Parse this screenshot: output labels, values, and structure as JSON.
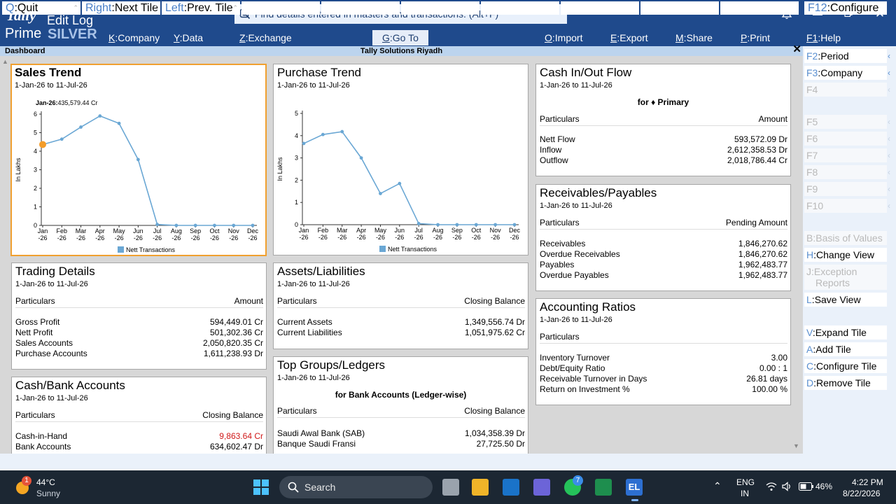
{
  "app": {
    "logo_line1": "Tally",
    "logo_line2": "Prime",
    "edition": "SILVER",
    "title": "Edit Log",
    "search_placeholder": "Find details entered in masters and transactions. (Alt+F)"
  },
  "menu": [
    {
      "key": "K",
      "label": "Company"
    },
    {
      "key": "Y",
      "label": "Data"
    },
    {
      "key": "Z",
      "label": "Exchange"
    },
    {
      "key": "G",
      "label": "Go To"
    },
    {
      "key": "O",
      "label": "Import"
    },
    {
      "key": "E",
      "label": "Export"
    },
    {
      "key": "M",
      "label": "Share"
    },
    {
      "key": "P",
      "label": "Print"
    },
    {
      "key": "F1",
      "label": "Help"
    }
  ],
  "subheader": {
    "left": "Dashboard",
    "center": "Tally Solutions Riyadh"
  },
  "tiles": {
    "sales_trend": {
      "title": "Sales Trend",
      "date": "1-Jan-26 to 11-Jul-26",
      "tooltip_label": "Jan-26:",
      "tooltip_value": "435,579.44 Cr"
    },
    "purchase_trend": {
      "title": "Purchase Trend",
      "date": "1-Jan-26 to 11-Jul-26"
    },
    "cash_flow": {
      "title": "Cash In/Out Flow",
      "date": "1-Jan-26 to 11-Jul-26",
      "for": "for ♦ Primary",
      "col1": "Particulars",
      "col2": "Amount",
      "rows": [
        {
          "label": "Nett Flow",
          "value": "593,572.09 Dr"
        },
        {
          "label": "Inflow",
          "value": "2,612,358.53 Dr"
        },
        {
          "label": "Outflow",
          "value": "2,018,786.44 Cr"
        }
      ]
    },
    "receivables": {
      "title": "Receivables/Payables",
      "date": "1-Jan-26 to 11-Jul-26",
      "col1": "Particulars",
      "col2": "Pending Amount",
      "rows": [
        {
          "label": "Receivables",
          "value": "1,846,270.62"
        },
        {
          "label": "Overdue Receivables",
          "value": "1,846,270.62"
        },
        {
          "label": "Payables",
          "value": "1,962,483.77"
        },
        {
          "label": "Overdue Payables",
          "value": "1,962,483.77"
        }
      ]
    },
    "trading": {
      "title": "Trading Details",
      "date": "1-Jan-26 to 11-Jul-26",
      "col1": "Particulars",
      "col2": "Amount",
      "rows": [
        {
          "label": "Gross Profit",
          "value": "594,449.01 Cr"
        },
        {
          "label": "Nett Profit",
          "value": "501,302.36 Cr"
        },
        {
          "label": "Sales Accounts",
          "value": "2,050,820.35 Cr"
        },
        {
          "label": "Purchase Accounts",
          "value": "1,611,238.93 Dr"
        }
      ]
    },
    "assets": {
      "title": "Assets/Liabilities",
      "date": "1-Jan-26 to 11-Jul-26",
      "col1": "Particulars",
      "col2": "Closing Balance",
      "rows": [
        {
          "label": "Current Assets",
          "value": "1,349,556.74 Dr"
        },
        {
          "label": "Current Liabilities",
          "value": "1,051,975.62 Cr"
        }
      ]
    },
    "ratios": {
      "title": "Accounting Ratios",
      "date": "1-Jan-26 to 11-Jul-26",
      "col1": "Particulars",
      "rows": [
        {
          "label": "Inventory Turnover",
          "value": "3.00"
        },
        {
          "label": "Debt/Equity Ratio",
          "value": "0.00 : 1"
        },
        {
          "label": "Receivable Turnover in Days",
          "value": "26.81 days"
        },
        {
          "label": "Return on Investment %",
          "value": "100.00 %"
        }
      ]
    },
    "cashbank": {
      "title": "Cash/Bank Accounts",
      "date": "1-Jan-26 to 11-Jul-26",
      "col1": "Particulars",
      "col2": "Closing Balance",
      "rows": [
        {
          "label": "Cash-in-Hand",
          "value": "9,863.64 Cr",
          "negative": true
        },
        {
          "label": "Bank Accounts",
          "value": "634,602.47 Dr"
        }
      ]
    },
    "topgroups": {
      "title": "Top Groups/Ledgers",
      "date": "1-Jan-26 to 11-Jul-26",
      "for": "for Bank Accounts (Ledger-wise)",
      "col1": "Particulars",
      "col2": "Closing Balance",
      "rows": [
        {
          "label": "Saudi Awal Bank (SAB)",
          "value": "1,034,358.39 Dr"
        },
        {
          "label": "Banque Saudi Fransi",
          "value": "27,725.50 Dr"
        }
      ]
    }
  },
  "chart_data": [
    {
      "type": "line",
      "title": "Sales Trend",
      "ylabel": "In Lakhs",
      "categories": [
        "Jan\n-26",
        "Feb\n-26",
        "Mar\n-26",
        "Apr\n-26",
        "May\n-26",
        "Jun\n-26",
        "Jul\n-26",
        "Aug\n-26",
        "Sep\n-26",
        "Oct\n-26",
        "Nov\n-26",
        "Dec\n-26"
      ],
      "yticks": [
        0,
        1,
        2,
        3,
        4,
        5,
        6
      ],
      "ylim": [
        0,
        6
      ],
      "series": [
        {
          "name": "Nett Transactions",
          "values": [
            4.36,
            4.65,
            5.3,
            5.9,
            5.5,
            3.55,
            0.05,
            0,
            0,
            0,
            0,
            0
          ]
        }
      ],
      "highlight_index": 0,
      "legend": "bottom-center",
      "color": "#6aa7d4"
    },
    {
      "type": "line",
      "title": "Purchase Trend",
      "ylabel": "In Lakhs",
      "categories": [
        "Jan\n-26",
        "Feb\n-26",
        "Mar\n-26",
        "Apr\n-26",
        "May\n-26",
        "Jun\n-26",
        "Jul\n-26",
        "Aug\n-26",
        "Sep\n-26",
        "Oct\n-26",
        "Nov\n-26",
        "Dec\n-26"
      ],
      "yticks": [
        0,
        1,
        2,
        3,
        4,
        5
      ],
      "ylim": [
        0,
        5
      ],
      "series": [
        {
          "name": "Nett Transactions",
          "values": [
            3.65,
            4.05,
            4.18,
            3.0,
            1.4,
            1.85,
            0.05,
            0,
            0,
            0,
            0,
            0
          ]
        }
      ],
      "legend": "bottom-center",
      "color": "#6aa7d4"
    }
  ],
  "right_panel": [
    {
      "key": "F2",
      "label": "Period",
      "enabled": true,
      "chev": true
    },
    {
      "key": "F3",
      "label": "Company",
      "enabled": true,
      "chev": true
    },
    {
      "key": "F4",
      "label": "",
      "enabled": false
    },
    {
      "key": "F5",
      "label": "",
      "enabled": false
    },
    {
      "key": "F6",
      "label": "",
      "enabled": false
    },
    {
      "key": "F7",
      "label": "",
      "enabled": false
    },
    {
      "key": "F8",
      "label": "",
      "enabled": false
    },
    {
      "key": "F9",
      "label": "",
      "enabled": false
    },
    {
      "key": "F10",
      "label": "",
      "enabled": false
    },
    {
      "key": "B",
      "label": "Basis of Values",
      "enabled": false
    },
    {
      "key": "H",
      "label": "Change View",
      "enabled": true
    },
    {
      "key": "J",
      "label": "Exception",
      "label2": "Reports",
      "enabled": false
    },
    {
      "key": "L",
      "label": "Save View",
      "enabled": true
    },
    {
      "key": "V",
      "label": "Expand Tile",
      "enabled": true
    },
    {
      "key": "A",
      "label": "Add Tile",
      "enabled": true
    },
    {
      "key": "C",
      "label": "Configure Tile",
      "enabled": true
    },
    {
      "key": "D",
      "label": "Remove Tile",
      "enabled": true
    }
  ],
  "bottom_bar": [
    {
      "key": "Q",
      "label": "Quit"
    },
    {
      "key": "Right",
      "label": "Next Tile"
    },
    {
      "key": "Left",
      "label": "Prev. Tile"
    },
    {
      "key": "F12",
      "label": "Configure"
    }
  ],
  "taskbar": {
    "temp": "44°C",
    "condition": "Sunny",
    "weather_badge": "1",
    "search": "Search",
    "lang1": "ENG",
    "lang2": "IN",
    "battery": "46%",
    "time": "4:22 PM",
    "date": "8/22/2026",
    "teams_badge": "7",
    "app_label": "EL"
  },
  "colors": {
    "header": "#1f4a8c",
    "subheader": "#bcd4ee",
    "dashboard_bg": "#d7d7d7",
    "accent": "#f0a030",
    "chart_line": "#6aa7d4"
  }
}
